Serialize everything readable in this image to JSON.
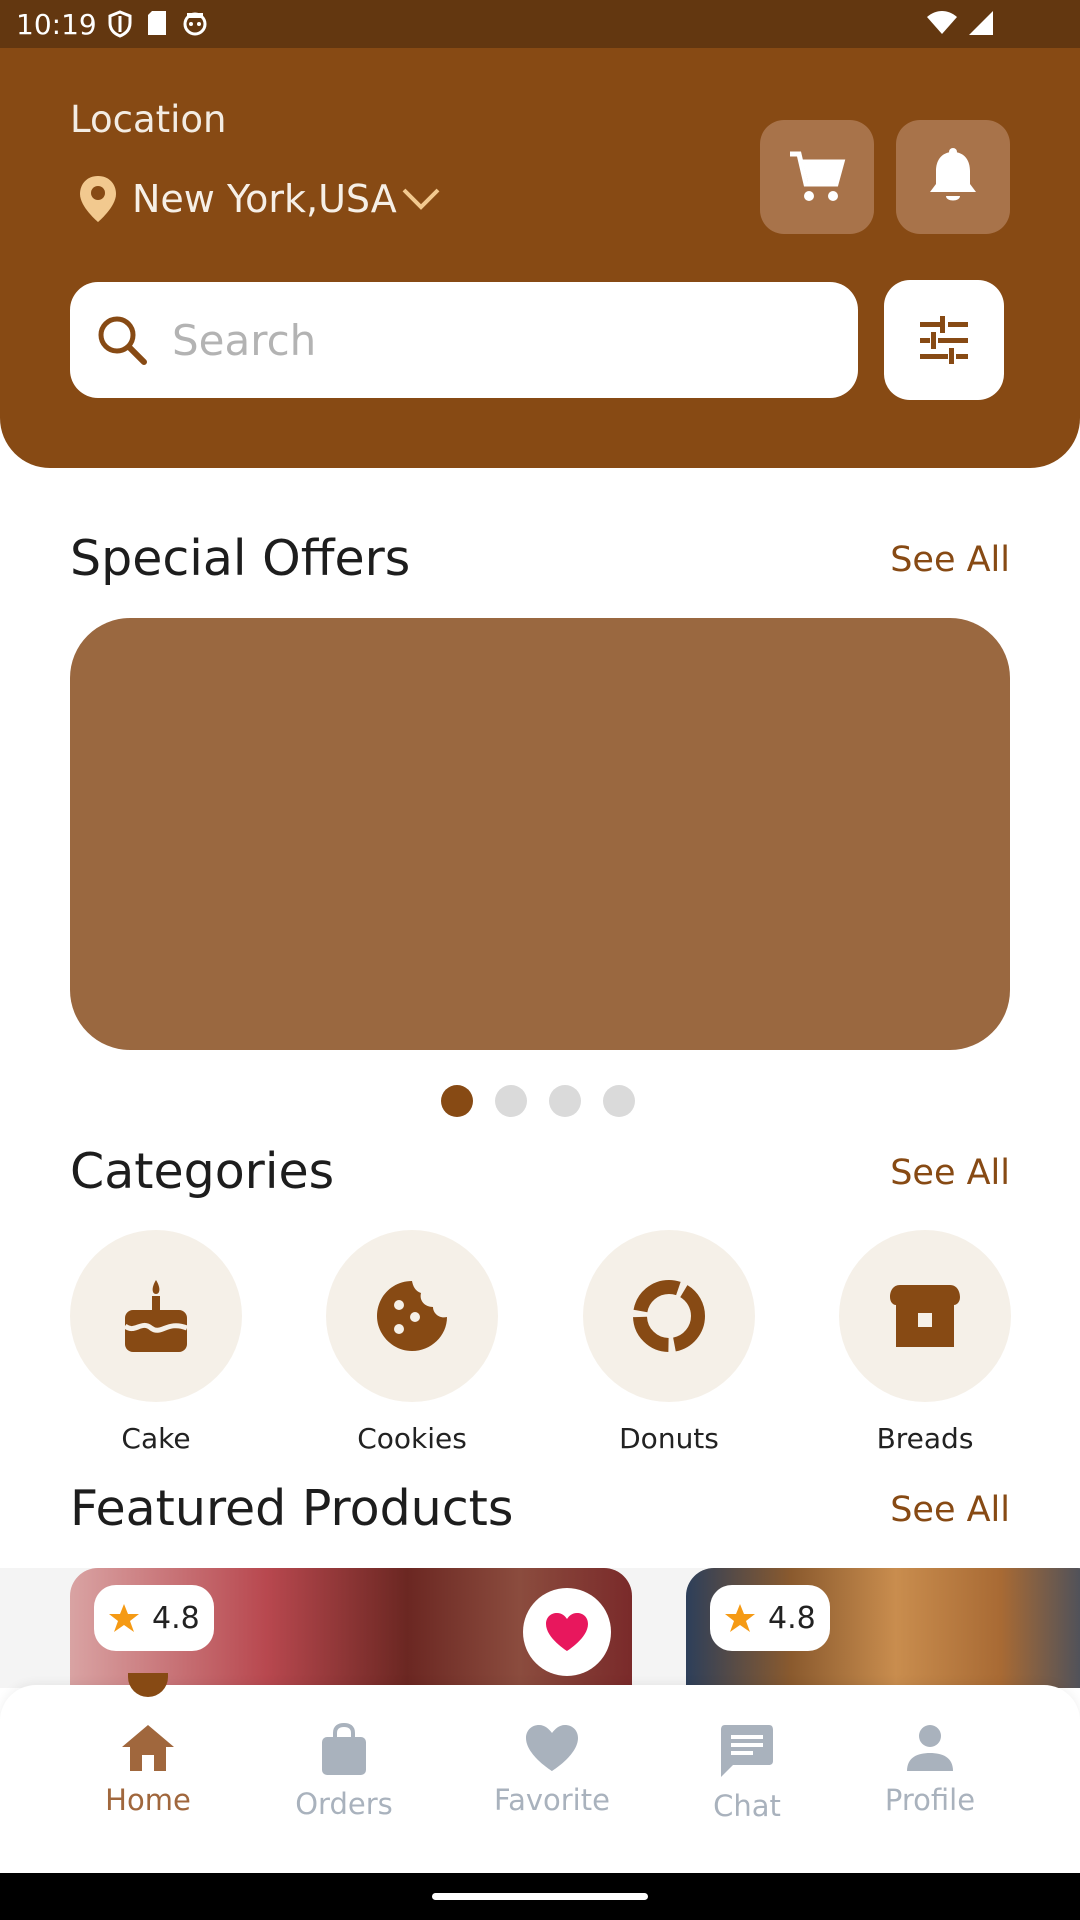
{
  "status_bar": {
    "time": "10:19"
  },
  "header": {
    "location_label": "Location",
    "location_value": "New York,USA",
    "search_placeholder": "Search"
  },
  "special_offers": {
    "title": "Special Offers",
    "see_all": "See All",
    "carousel_pages": 4,
    "active_page": 1
  },
  "categories": {
    "title": "Categories",
    "see_all": "See All",
    "items": [
      {
        "label": "Cake",
        "icon": "cake-icon"
      },
      {
        "label": "Cookies",
        "icon": "cookie-icon"
      },
      {
        "label": "Donuts",
        "icon": "donut-icon"
      },
      {
        "label": "Breads",
        "icon": "bread-icon"
      }
    ]
  },
  "featured_products": {
    "title": "Featured Products",
    "see_all": "See All",
    "items": [
      {
        "rating": "4.8",
        "favorite": true
      },
      {
        "rating": "4.8"
      }
    ]
  },
  "bottom_nav": {
    "items": [
      {
        "label": "Home",
        "icon": "home-icon",
        "active": true
      },
      {
        "label": "Orders",
        "icon": "shopping-bag-icon"
      },
      {
        "label": "Favorite",
        "icon": "heart-icon"
      },
      {
        "label": "Chat",
        "icon": "chat-icon"
      },
      {
        "label": "Profile",
        "icon": "person-icon"
      }
    ]
  },
  "colors": {
    "brand": "#874A14",
    "status_bar": "#633710",
    "banner": "#9A6840",
    "favorite": "#E8175D",
    "star": "#F59A14"
  }
}
